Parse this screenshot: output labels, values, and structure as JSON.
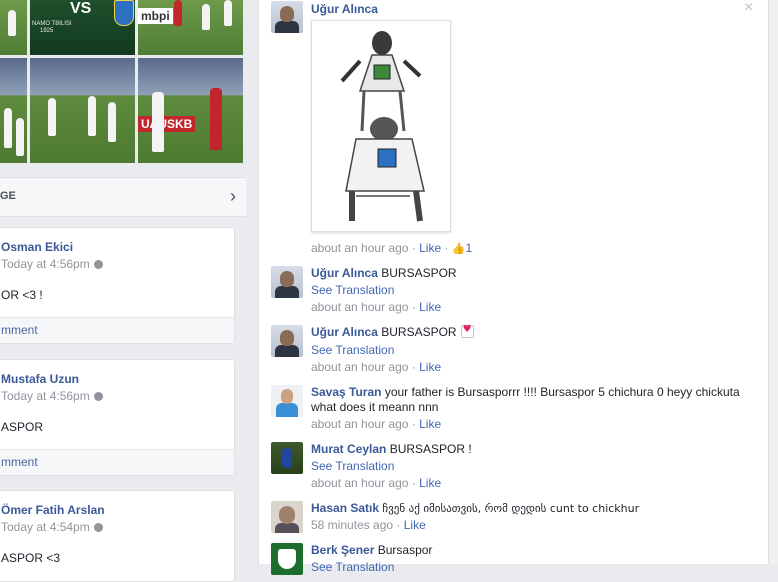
{
  "left_panel": {
    "photos": {
      "team_badge_text": "VS",
      "subtitle_left": "NAMO TBILISI",
      "year": "1925",
      "ad_text_1": "mbpi",
      "ad_text_2": "UAUSKB"
    },
    "panel_header": {
      "title": "GE",
      "chevron": "chevron-right-icon"
    },
    "posts": [
      {
        "name": "Osman Ekici",
        "time": "Today at 4:56pm",
        "body": "OR <3 !",
        "action": "mment"
      },
      {
        "name": "Mustafa Uzun",
        "time": "Today at 4:56pm",
        "body": "ASPOR",
        "action": "mment"
      },
      {
        "name": "Ömer Fatih Arslan",
        "time": "Today at 4:54pm",
        "body": "ASPOR <3",
        "action": ""
      }
    ]
  },
  "comments": [
    {
      "name": "Uğur Alınca",
      "text": "",
      "meta_time": "about an hour ago",
      "meta_like": "Like",
      "like_count": "1",
      "has_image": true
    },
    {
      "name": "Uğur Alınca",
      "text": "BURSASPOR",
      "see_translation": "See Translation",
      "meta_time": "about an hour ago",
      "meta_like": "Like"
    },
    {
      "name": "Uğur Alınca",
      "text": "BURSASPOR",
      "see_translation": "See Translation",
      "meta_time": "about an hour ago",
      "meta_like": "Like"
    },
    {
      "name": "Savaş Turan",
      "text": "your father is Bursasporrr !!!! Bursaspor 5 chichura 0 heyy chickuta what does it meann nnn",
      "meta_time": "about an hour ago",
      "meta_like": "Like"
    },
    {
      "name": "Murat Ceylan",
      "text": "BURSASPOR !",
      "see_translation": "See Translation",
      "meta_time": "about an hour ago",
      "meta_like": "Like"
    },
    {
      "name": "Hasan Satık",
      "text": "ჩვენ აქ იმისათვის, რომ დედის cunt to chickhur",
      "meta_time": "58 minutes ago",
      "meta_like": "Like"
    },
    {
      "name": "Berk Şener",
      "text": "Bursaspor",
      "see_translation": "See Translation"
    }
  ],
  "dot_separator": "·",
  "close_symbol": "×",
  "like_thumb": "👍",
  "colors": {
    "link": "#3b5998",
    "meta": "#90949c",
    "background": "#e9ebee"
  }
}
